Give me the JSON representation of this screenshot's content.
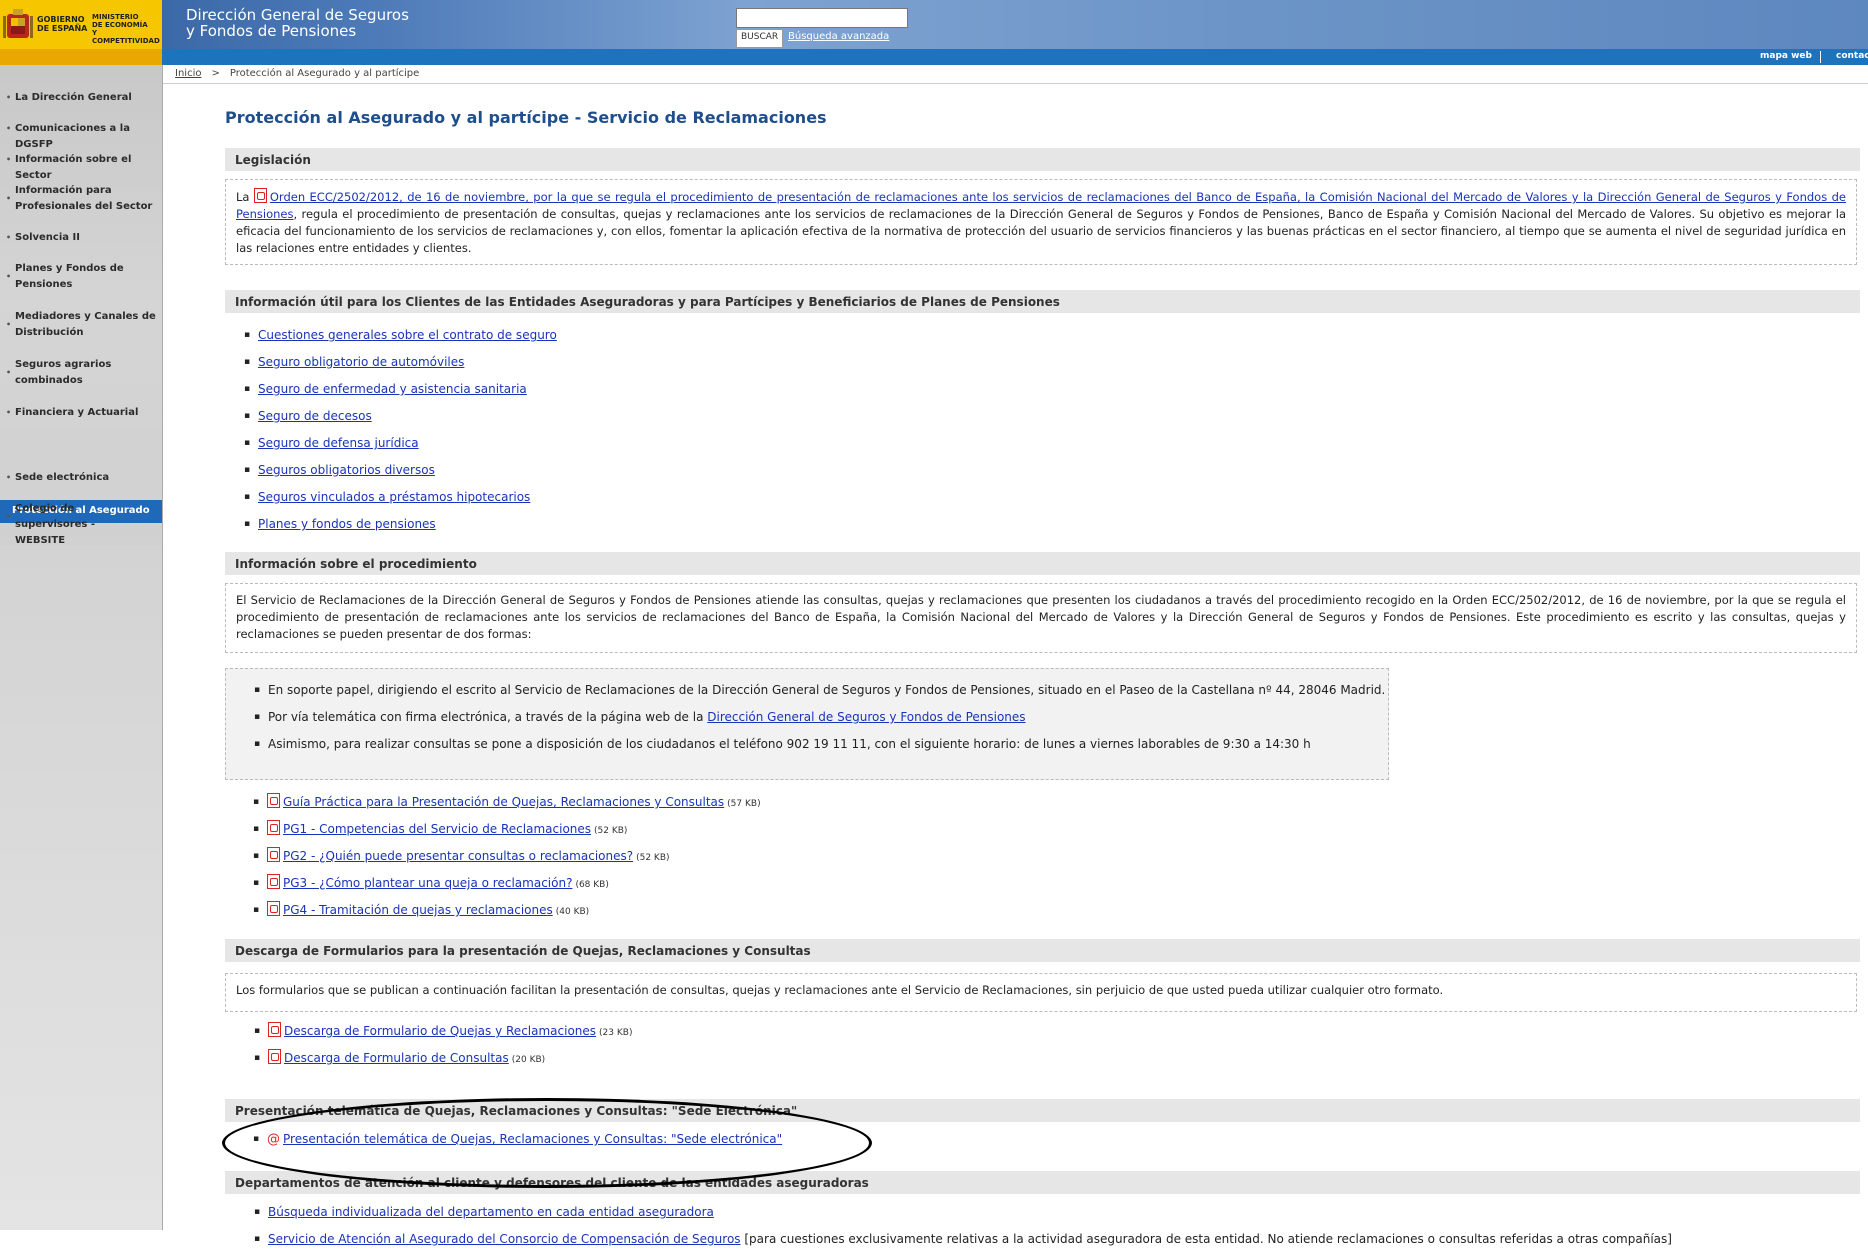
{
  "header": {
    "gov_line1": "GOBIERNO\nDE ESPAÑA",
    "gov_line2": "MINISTERIO\nDE ECONOMÍA\nY COMPETITIVIDAD",
    "title_line1": "Dirección General de Seguros",
    "title_line2": "y Fondos de Pensiones",
    "search_placeholder": "",
    "search_button": "BUSCAR",
    "advanced_search": "Búsqueda avanzada"
  },
  "topbar": {
    "site_map": "mapa web",
    "contact": "contact"
  },
  "breadcrumb": {
    "home": "Inicio",
    "separator": ">",
    "current": "Protección al Asegurado y al partícipe"
  },
  "sidebar": {
    "items": [
      "La Dirección General",
      "Comunicaciones a la DGSFP",
      "Información sobre el Sector",
      "Información para Profesionales del Sector",
      "Solvencia II",
      "Planes y Fondos de Pensiones",
      "Mediadores y Canales de Distribución",
      "Seguros agrarios combinados",
      "Financiera y Actuarial",
      "Protección al Asegurado",
      "Sede electrónica",
      "Colegio de supervisores - WEBSITE"
    ]
  },
  "main": {
    "title": "Protección al Asegurado y al partícipe - Servicio de Reclamaciones",
    "legislacion": {
      "heading": "Legislación",
      "prefix": "La ",
      "link": "Orden ECC/2502/2012, de 16 de noviembre, por la que se regula el procedimiento de presentación de reclamaciones ante los servicios de reclamaciones del Banco de España, la Comisión Nacional del Mercado de Valores y la Dirección General de Seguros y Fondos de Pensiones",
      "text": ", regula el procedimiento de presentación de consultas, quejas y reclamaciones ante los servicios de reclamaciones de la Dirección General de Seguros y Fondos de Pensiones, Banco de España y Comisión Nacional del Mercado de Valores. Su objetivo es mejorar la eficacia del funcionamiento de los servicios de reclamaciones y, con ellos, fomentar la aplicación efectiva de la normativa de protección del usuario de servicios financieros y las buenas prácticas en el sector financiero, al tiempo que se aumenta el nivel de seguridad jurídica en las relaciones entre entidades y clientes."
    },
    "info_util": {
      "heading": "Información útil para los Clientes de las Entidades Aseguradoras y para Partícipes y Beneficiarios de Planes de Pensiones",
      "links": [
        "Cuestiones generales sobre el contrato de seguro",
        "Seguro obligatorio de automóviles",
        "Seguro de enfermedad y asistencia sanitaria",
        "Seguro de decesos",
        "Seguro de defensa jurídica",
        "Seguros obligatorios diversos",
        "Seguros vinculados a préstamos hipotecarios",
        "Planes y fondos de pensiones"
      ]
    },
    "procedimiento": {
      "heading": "Información sobre el procedimiento",
      "text": "El Servicio de Reclamaciones de la Dirección General de Seguros y Fondos de Pensiones atiende las consultas, quejas y reclamaciones que presenten los ciudadanos a través del procedimiento recogido en la Orden ECC/2502/2012, de 16 de noviembre, por la que se regula el procedimiento de presentación de reclamaciones ante los servicios de reclamaciones del Banco de España, la Comisión Nacional del Mercado de Valores y la Dirección General de Seguros y Fondos de Pensiones. Este procedimiento es escrito y las consultas, quejas y reclamaciones se pueden presentar de dos formas:",
      "ways": {
        "paper": "En soporte papel, dirigiendo el escrito al Servicio de Reclamaciones de la Dirección General de Seguros y Fondos de Pensiones, situado en el Paseo de la Castellana nº 44, 28046 Madrid.",
        "online_prefix": "Por vía telemática con firma electrónica, a través de la página web de la ",
        "online_link": "Dirección General de Seguros y Fondos de Pensiones",
        "phone": "Asimismo, para realizar consultas se pone a disposición de los ciudadanos el teléfono 902 19 11 11, con el siguiente horario: de lunes a viernes laborables de 9:30 a 14:30 h"
      },
      "docs": [
        {
          "label": "Guía Práctica para la Presentación de Quejas, Reclamaciones y Consultas",
          "size": "(57 KB)"
        },
        {
          "label": "PG1 - Competencias del Servicio de Reclamaciones",
          "size": "(52 KB)"
        },
        {
          "label": "PG2 - ¿Quién puede presentar consultas o reclamaciones?",
          "size": "(52 KB)"
        },
        {
          "label": "PG3 - ¿Cómo plantear una queja o reclamación?",
          "size": "(68 KB)"
        },
        {
          "label": "PG4 - Tramitación de quejas y reclamaciones",
          "size": "(40 KB)"
        }
      ]
    },
    "formularios": {
      "heading": "Descarga de Formularios para la presentación de Quejas, Reclamaciones y Consultas",
      "text": "Los formularios que se publican a continuación facilitan la presentación de consultas, quejas y reclamaciones ante el Servicio de Reclamaciones, sin perjuicio de que usted pueda utilizar cualquier otro formato.",
      "docs": [
        {
          "label": "Descarga de Formulario de Quejas y Reclamaciones",
          "size": "(23 KB)"
        },
        {
          "label": "Descarga de Formulario de Consultas",
          "size": "(20 KB)"
        }
      ]
    },
    "telematica": {
      "heading": "Presentación telemática de Quejas, Reclamaciones y Consultas: \"Sede Electrónica\"",
      "link": "Presentación telemática de Quejas, Reclamaciones y Consultas: \"Sede electrónica\""
    },
    "departamentos": {
      "heading": "Departamentos de atención al cliente y defensores del cliente de las entidades aseguradoras",
      "link1": "Búsqueda individualizada del departamento en cada entidad aseguradora",
      "link2": "Servicio de Atención al Asegurado del Consorcio de Compensación de Seguros",
      "link2_suffix": " [para cuestiones exclusivamente relativas a la actividad aseguradora de esta entidad. No atiende reclamaciones o consultas referidas a otras compañías]"
    }
  }
}
